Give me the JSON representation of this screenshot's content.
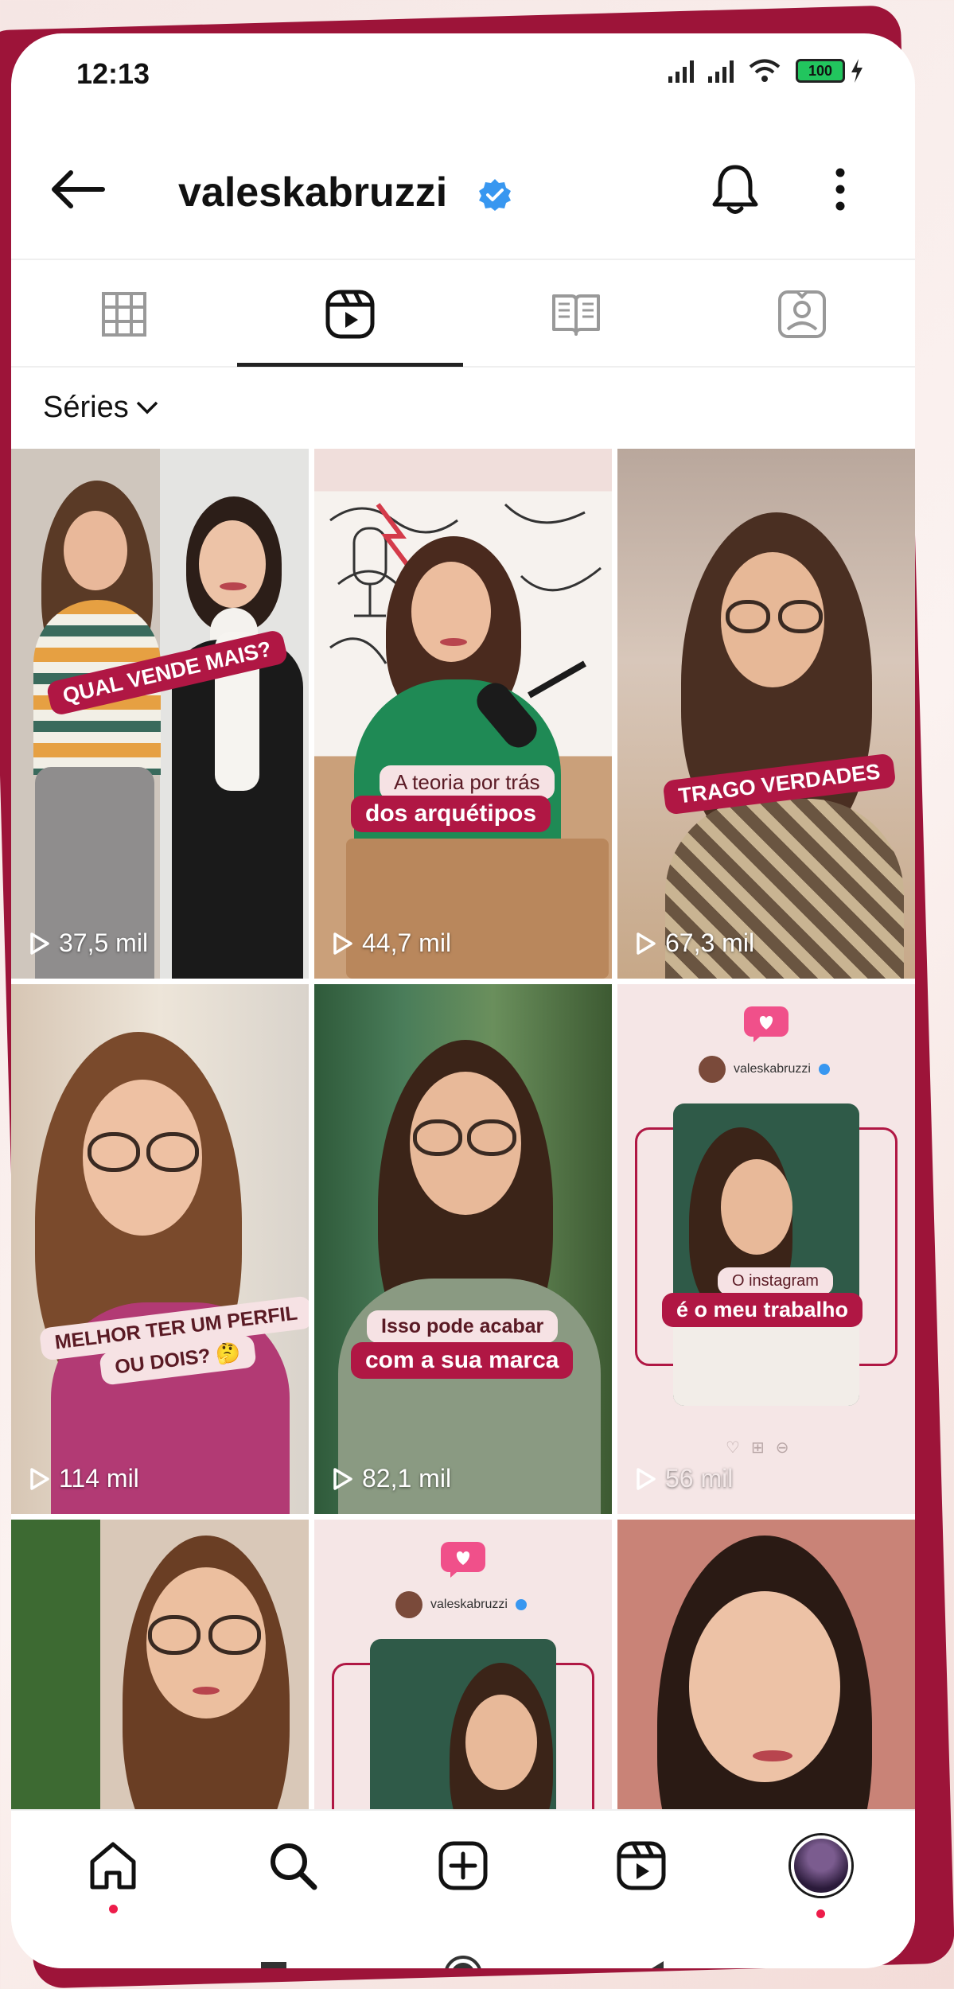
{
  "status_bar": {
    "time": "12:13",
    "battery": "100"
  },
  "header": {
    "username": "valeskabruzzi",
    "verified": true,
    "icons": [
      "back-arrow-icon",
      "verified-badge-icon",
      "bell-icon",
      "more-vertical-icon"
    ]
  },
  "tabs": [
    {
      "name": "posts-grid",
      "icon": "grid-icon",
      "active": false
    },
    {
      "name": "reels",
      "icon": "reels-icon",
      "active": true
    },
    {
      "name": "guides",
      "icon": "guide-book-icon",
      "active": false
    },
    {
      "name": "tagged",
      "icon": "tagged-person-icon",
      "active": false
    }
  ],
  "filter": {
    "label": "Séries"
  },
  "reels": [
    {
      "views": "37,5 mil",
      "caption": "QUAL VENDE MAIS?"
    },
    {
      "views": "44,7 mil",
      "caption_top": "A teoria por trás",
      "caption": "dos arquétipos"
    },
    {
      "views": "67,3 mil",
      "caption": "TRAGO VERDADES"
    },
    {
      "views": "114 mil",
      "caption_top": "MELHOR TER UM PERFIL",
      "caption": "OU DOIS? 🤔"
    },
    {
      "views": "82,1 mil",
      "caption_top": "Isso pode acabar",
      "caption": "com a sua marca"
    },
    {
      "views": "56 mil",
      "handle": "valeskabruzzi",
      "caption_top": "O instagram",
      "caption": "é o meu trabalho"
    },
    {
      "views": ""
    },
    {
      "views": "",
      "handle": "valeskabruzzi"
    },
    {
      "views": ""
    }
  ],
  "bottom_nav": [
    "home-icon",
    "search-icon",
    "create-icon",
    "reels-icon",
    "profile-avatar"
  ],
  "system_nav": [
    "recent-apps-icon",
    "home-circle-icon",
    "back-triangle-icon"
  ],
  "colors": {
    "brand": "#b01744",
    "deco": "#9d1439",
    "verified": "#3897f0",
    "notification_dot": "#ed1c4a"
  }
}
